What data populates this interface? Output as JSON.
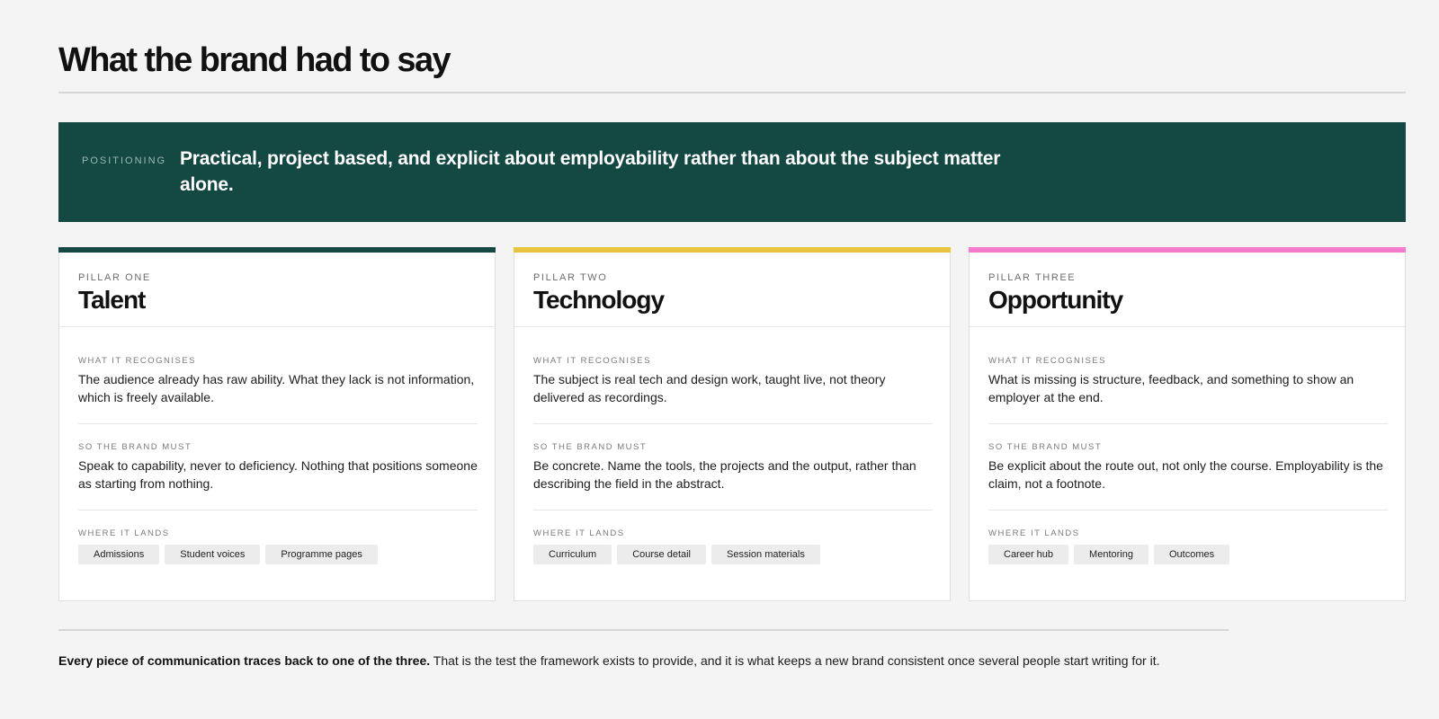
{
  "header": {
    "title": "What the brand had to say"
  },
  "positioning": {
    "label": "POSITIONING",
    "text": "Practical, project based, and explicit about employability rather than about the subject matter alone."
  },
  "pillars": [
    {
      "kicker": "PILLAR ONE",
      "name": "Talent",
      "accent": "#134843",
      "recognises_label": "WHAT IT RECOGNISES",
      "recognises": "The audience already has raw ability. What they lack is not information, which is freely available.",
      "must_label": "SO THE BRAND MUST",
      "must": "Speak to capability, never to deficiency. Nothing that positions someone as starting from nothing.",
      "lands_label": "WHERE IT LANDS",
      "tags": [
        "Admissions",
        "Student voices",
        "Programme pages"
      ]
    },
    {
      "kicker": "PILLAR TWO",
      "name": "Technology",
      "accent": "#e8c53f",
      "recognises_label": "WHAT IT RECOGNISES",
      "recognises": "The subject is real tech and design work, taught live, not theory delivered as recordings.",
      "must_label": "SO THE BRAND MUST",
      "must": "Be concrete. Name the tools, the projects and the output, rather than describing the field in the abstract.",
      "lands_label": "WHERE IT LANDS",
      "tags": [
        "Curriculum",
        "Course detail",
        "Session materials"
      ]
    },
    {
      "kicker": "PILLAR THREE",
      "name": "Opportunity",
      "accent": "#f57bcf",
      "recognises_label": "WHAT IT RECOGNISES",
      "recognises": "What is missing is structure, feedback, and something to show an employer at the end.",
      "must_label": "SO THE BRAND MUST",
      "must": "Be explicit about the route out, not only the course. Employability is the claim, not a footnote.",
      "lands_label": "WHERE IT LANDS",
      "tags": [
        "Career hub",
        "Mentoring",
        "Outcomes"
      ]
    }
  ],
  "footer": {
    "bold": "Every piece of communication traces back to one of the three.",
    "rest": " That is the test the framework exists to provide, and it is what keeps a new brand consistent once several people start writing for it."
  }
}
